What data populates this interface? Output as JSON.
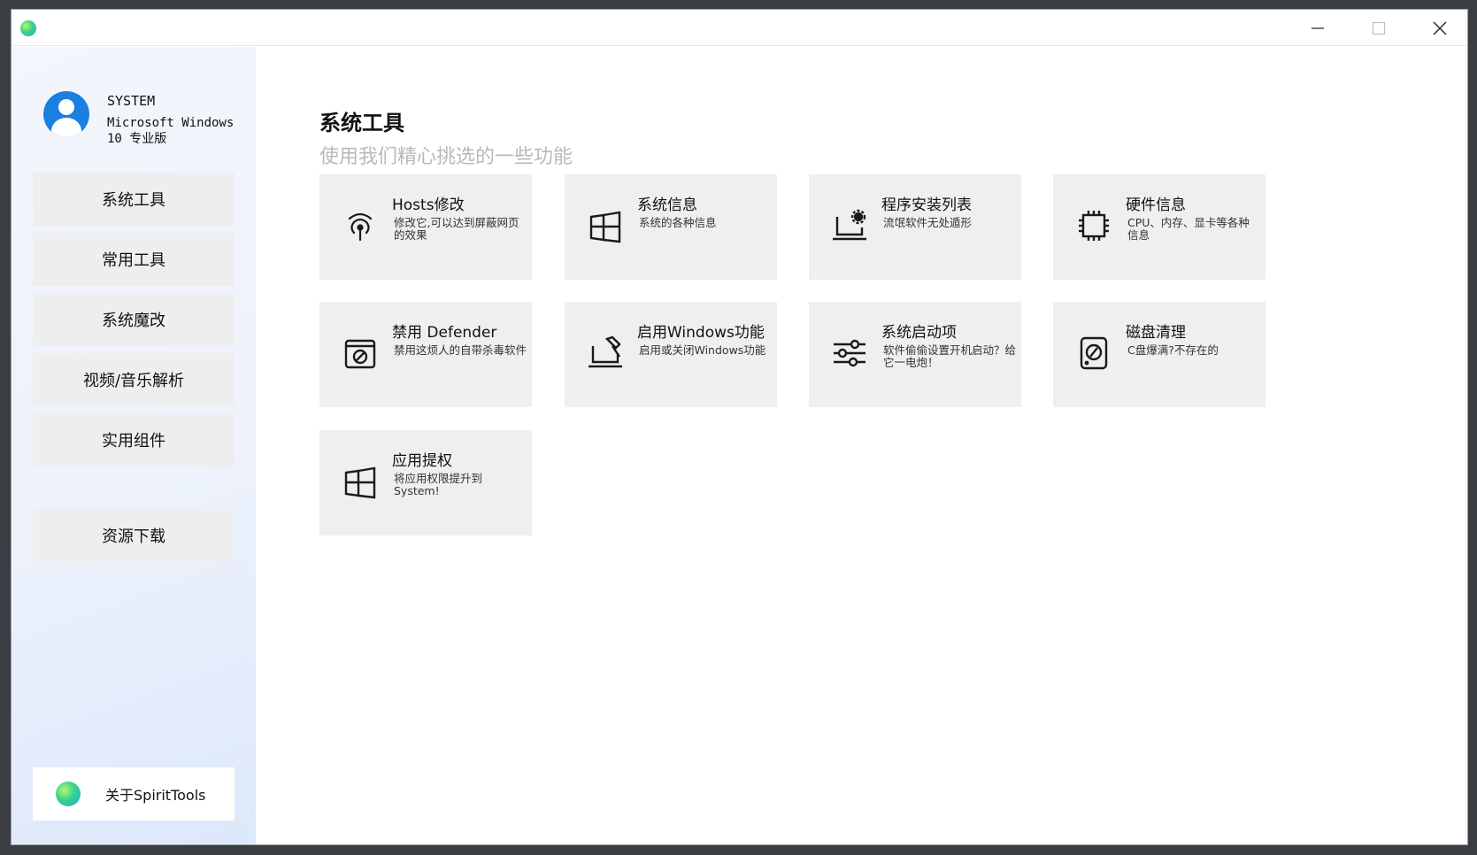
{
  "window": {
    "controls": {
      "minimize": "minimize-icon",
      "maximize": "maximize-icon",
      "close": "close-icon"
    }
  },
  "user": {
    "name": "SYSTEM",
    "os": "Microsoft Windows 10 专业版"
  },
  "sidebar": {
    "items": [
      {
        "label": "系统工具"
      },
      {
        "label": "常用工具"
      },
      {
        "label": "系统魔改"
      },
      {
        "label": "视频/音乐解析"
      },
      {
        "label": "实用组件"
      },
      {
        "label": "资源下载"
      }
    ],
    "about_label": "关于SpiritTools"
  },
  "main": {
    "title": "系统工具",
    "subtitle": "使用我们精心挑选的一些功能",
    "cards": [
      {
        "title": "Hosts修改",
        "desc": "修改它,可以达到屏蔽网页的效果",
        "icon": "broadcast-icon"
      },
      {
        "title": "系统信息",
        "desc": "系统的各种信息",
        "icon": "windows-logo-icon"
      },
      {
        "title": "程序安装列表",
        "desc": "流氓软件无处遁形",
        "icon": "laptop-gear-icon"
      },
      {
        "title": "硬件信息",
        "desc": "CPU、内存、显卡等各种信息",
        "icon": "cpu-chip-icon"
      },
      {
        "title": "禁用 Defender",
        "desc": "禁用这烦人的自带杀毒软件",
        "icon": "block-window-icon"
      },
      {
        "title": "启用Windows功能",
        "desc": "启用或关闭Windows功能",
        "icon": "laptop-wrench-icon"
      },
      {
        "title": "系统启动项",
        "desc": "软件偷偷设置开机启动？给它一电炮！",
        "icon": "sliders-icon"
      },
      {
        "title": "磁盘清理",
        "desc": "C盘爆满?不存在的",
        "icon": "hard-disk-icon"
      },
      {
        "title": "应用提权",
        "desc": "将应用权限提升到System!",
        "icon": "windows-logo-icon"
      }
    ]
  },
  "colors": {
    "card_bg": "#efefef",
    "nav_bg": "#eeeeee",
    "subtitle": "#b9b9b9",
    "avatar": "#1b7fe0"
  }
}
